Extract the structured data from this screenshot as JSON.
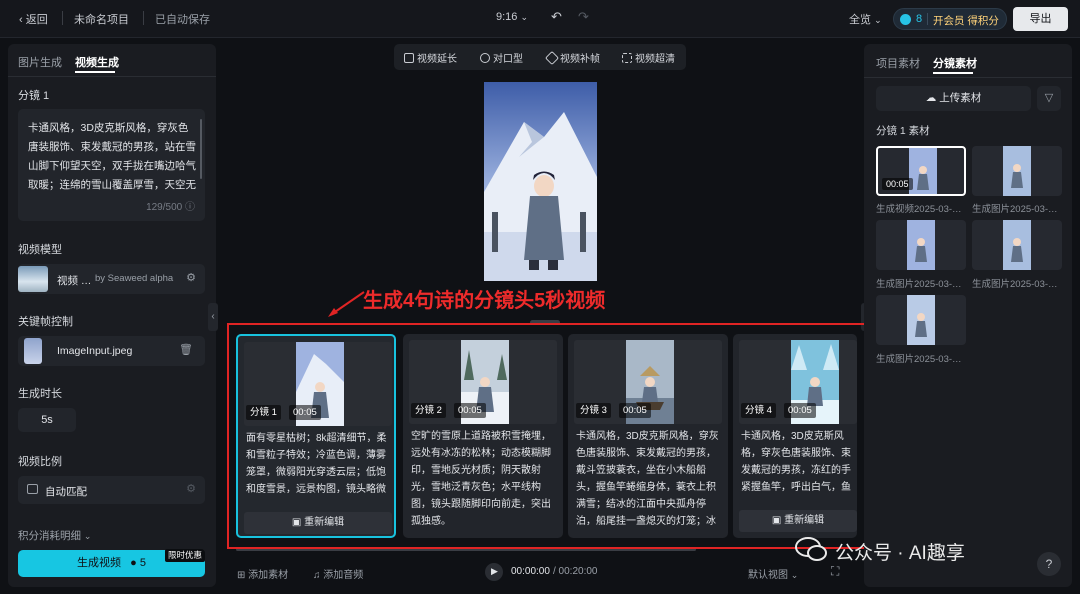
{
  "topbar": {
    "back": "返回",
    "project_name": "未命名项目",
    "autosave": "已自动保存",
    "timestamp": "9:16",
    "view_mode": "全览",
    "credits": "8",
    "member_cta": "开会员 得积分",
    "export": "导出"
  },
  "left_panel": {
    "tabs": [
      "图片生成",
      "视频生成"
    ],
    "active_tab": 1,
    "shot_title": "分镜 1",
    "prompt": "卡通风格，3D皮克斯风格，穿灰色唐装服饰、束发戴冠的男孩，站在雪山脚下仰望天空，双手拢在嘴边哈气取暖；连绵的雪山覆盖厚雪，天空无乌",
    "char_count": "129/500",
    "model_label": "视频模型",
    "model_name": "视频 …",
    "model_provider": "by Seaweed alpha",
    "keyframe_label": "关键帧控制",
    "keyframe_file": "ImageInput.jpeg",
    "duration_label": "生成时长",
    "duration_value": "5s",
    "ratio_label": "视频比例",
    "ratio_value": "自动匹配",
    "credits_detail": "积分消耗明细",
    "generate_button": "生成视频",
    "generate_cost": "5",
    "promo_badge": "限时优惠"
  },
  "toolbar": {
    "tools": [
      "视频延长",
      "对口型",
      "视频补帧",
      "视频超清"
    ]
  },
  "annotation": "生成4句诗的分镜头5秒视频",
  "storyboard": [
    {
      "label": "分镜 1",
      "time": "00:05",
      "text": "面有零星枯树；8k超清细节，柔和雪粒子特效；冷蓝色调，薄雾笼罩，微弱阳光穿透云层；低饱和度雪景，远景构图，镜头略微俯视。",
      "button": "重新编辑"
    },
    {
      "label": "分镜 2",
      "time": "00:05",
      "text": "空旷的雪原上道路被积雪掩埋，远处有冰冻的松林；动态模糊脚印，雪地反光材质；阴天散射光，雪地泛青灰色；水平线构图，镜头跟随脚印向前走，突出孤独感。",
      "button": ""
    },
    {
      "label": "分镜 3",
      "time": "00:05",
      "text": "卡通风格，3D皮克斯风格，穿灰色唐装服饰、束发戴冠的男孩，戴斗笠披蓑衣，坐在小木船船头，握鱼竿蜷缩身体，蓑衣上积满雪；结冰的江面中央孤舟停泊，船尾挂一盏熄灭的灯笼；冰",
      "button": ""
    },
    {
      "label": "分镜 4",
      "time": "00:05",
      "text": "卡通风格，3D皮克斯风格，穿灰色唐装服饰、束发戴冠的男孩，冻红的手紧握鱼竿，呼出白气，鱼线垂入冰窟，雪花落",
      "button": "重新编辑"
    }
  ],
  "bottom_bar": {
    "add_asset": "添加素材",
    "add_audio": "添加音频",
    "current_time": "00:00:00",
    "total_time": "/ 00:20:00",
    "view": "默认视图"
  },
  "right_panel": {
    "tabs": [
      "项目素材",
      "分镜素材"
    ],
    "active_tab": 1,
    "upload": "上传素材",
    "section_title": "分镜 1 素材",
    "assets": [
      {
        "caption": "生成视频2025-03-…",
        "badge": "00:05"
      },
      {
        "caption": "生成图片2025-03-…",
        "badge": ""
      },
      {
        "caption": "生成图片2025-03-…",
        "badge": ""
      },
      {
        "caption": "生成图片2025-03-…",
        "badge": ""
      },
      {
        "caption": "生成图片2025-03-…",
        "badge": ""
      }
    ]
  },
  "watermark": "公众号 · AI趣享",
  "colors": {
    "accent": "#17c6e2",
    "annotation": "#e02424",
    "background": "#0f1115"
  }
}
